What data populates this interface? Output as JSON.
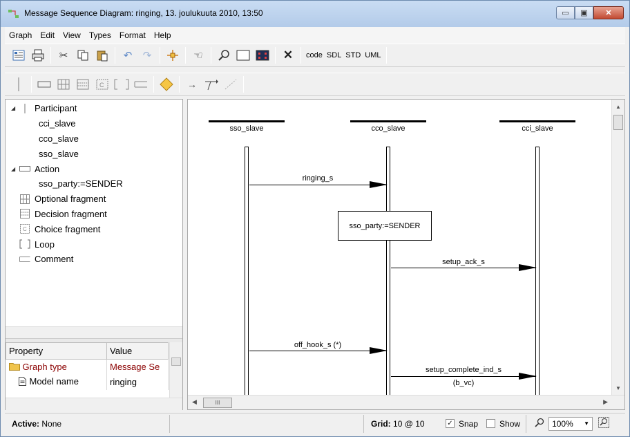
{
  "window": {
    "title": "Message Sequence Diagram: ringing, 13. joulukuuta 2010, 13:50",
    "minimize": "▭",
    "maximize": "▣",
    "close": "✕"
  },
  "menu": [
    {
      "label": "Graph"
    },
    {
      "label": "Edit"
    },
    {
      "label": "View"
    },
    {
      "label": "Types"
    },
    {
      "label": "Format"
    },
    {
      "label": "Help"
    }
  ],
  "toolbar1": {
    "icons": [
      "properties-icon",
      "print-icon",
      "cut-icon",
      "copy-icon",
      "paste-icon",
      "undo-icon",
      "redo-icon",
      "add-point-icon",
      "hand-icon",
      "zoom-icon",
      "fit-rect-icon",
      "fit-all-icon",
      "delete-icon"
    ],
    "text_buttons": [
      "code",
      "SDL",
      "STD",
      "UML"
    ]
  },
  "toolbar2": {
    "icons": [
      "participant-tool-icon",
      "action-tool-icon",
      "optional-fragment-tool-icon",
      "decision-fragment-tool-icon",
      "choice-fragment-tool-icon",
      "loop-tool-icon",
      "comment-tool-icon",
      "condition-tool-icon",
      "message-tool-icon",
      "create-message-tool-icon",
      "lost-message-tool-icon"
    ]
  },
  "tree": {
    "participant": "Participant",
    "participant_children": [
      "cci_slave",
      "cco_slave",
      "sso_slave"
    ],
    "action": "Action",
    "action_children": [
      "sso_party:=SENDER"
    ],
    "others": [
      {
        "label": "Optional fragment",
        "icon": "optional-fragment-icon"
      },
      {
        "label": "Decision fragment",
        "icon": "decision-fragment-icon"
      },
      {
        "label": "Choice fragment",
        "icon": "choice-fragment-icon"
      },
      {
        "label": "Loop",
        "icon": "loop-icon"
      },
      {
        "label": "Comment",
        "icon": "comment-icon"
      }
    ]
  },
  "properties": {
    "header_property": "Property",
    "header_value": "Value",
    "rows": [
      {
        "property": "Graph type",
        "value": "Message Se"
      },
      {
        "property": "Model name",
        "value": "ringing"
      }
    ]
  },
  "diagram": {
    "participants": [
      "sso_slave",
      "cco_slave",
      "cci_slave"
    ],
    "action": "sso_party:=SENDER",
    "messages": [
      {
        "label": "ringing_s"
      },
      {
        "label": "setup_ack_s"
      },
      {
        "label": "off_hook_s (*)"
      },
      {
        "label": "setup_complete_ind_s",
        "sublabel": "(b_vc)"
      }
    ],
    "hscroll_thumb": "III"
  },
  "status": {
    "active_label": "Active:",
    "active_value": "None",
    "grid_label": "Grid:",
    "grid_value": "10 @ 10",
    "snap_label": "Snap",
    "snap_checked": true,
    "show_label": "Show",
    "show_checked": false,
    "zoom_value": "100%"
  }
}
